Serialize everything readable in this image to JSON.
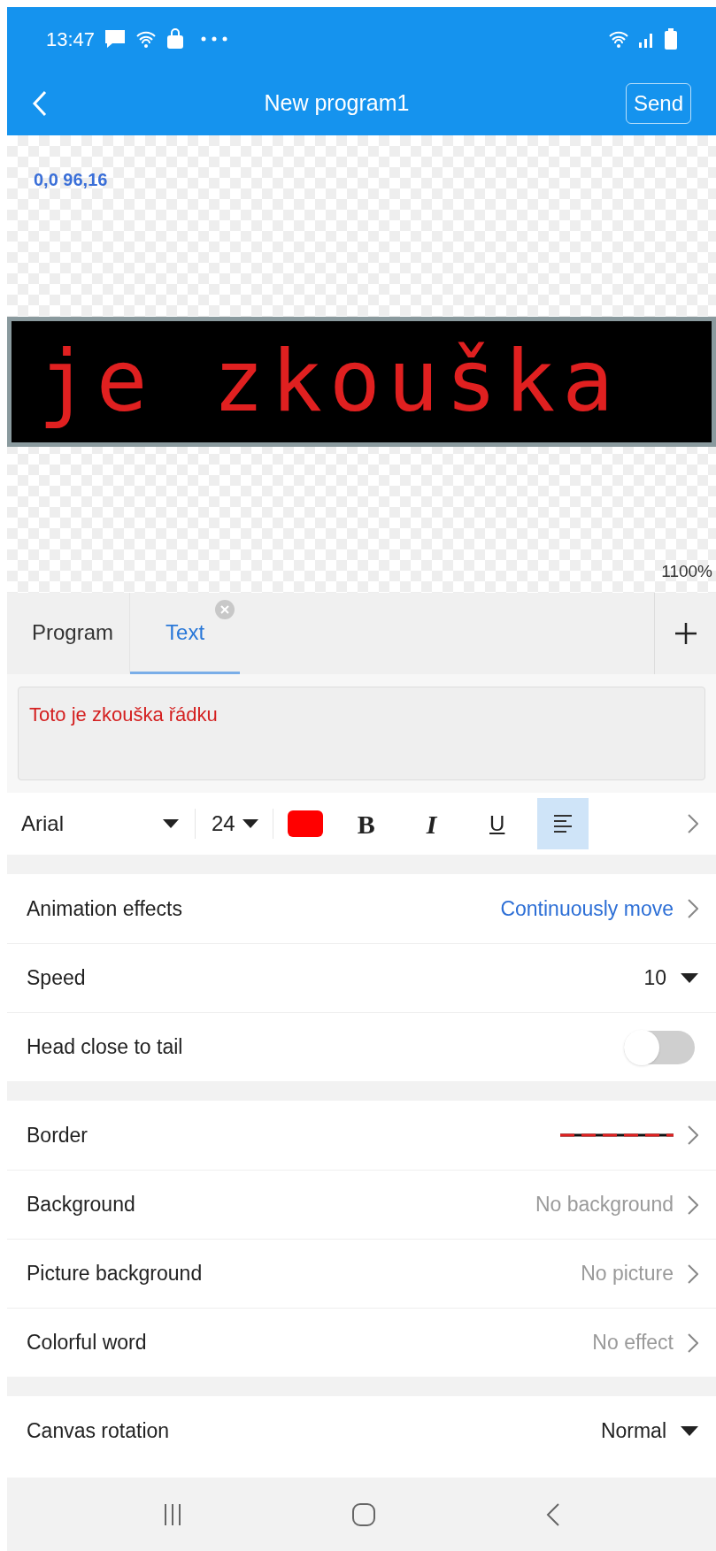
{
  "status_bar": {
    "time": "13:47"
  },
  "app_bar": {
    "title": "New program1",
    "send_button": "Send"
  },
  "canvas": {
    "coordinates": "0,0 96,16",
    "led_text": "je zkouška",
    "zoom": "1100%"
  },
  "tabs": [
    {
      "label": "Program",
      "selected": false,
      "closable": false
    },
    {
      "label": "Text",
      "selected": true,
      "closable": true
    }
  ],
  "text_input": {
    "value": "Toto je zkouška řádku"
  },
  "format_toolbar": {
    "font": "Arial",
    "size": "24",
    "color": "#ff0000",
    "buttons": [
      {
        "kind": "bold",
        "label": "B",
        "on": false
      },
      {
        "kind": "italic",
        "label": "I",
        "on": false
      },
      {
        "kind": "underline",
        "label": "U",
        "on": false
      },
      {
        "kind": "align",
        "on": true
      }
    ]
  },
  "settings_groups": [
    [
      {
        "kind": "link",
        "label": "Animation effects",
        "value": "Continuously move",
        "highlighted": true
      },
      {
        "kind": "dropdown",
        "label": "Speed",
        "value": "10"
      },
      {
        "kind": "toggle",
        "label": "Head close to tail",
        "on": false
      }
    ],
    [
      {
        "kind": "border",
        "label": "Border"
      },
      {
        "kind": "link",
        "label": "Background",
        "value": "No background",
        "highlighted": false
      },
      {
        "kind": "link",
        "label": "Picture background",
        "value": "No picture",
        "highlighted": false
      },
      {
        "kind": "link",
        "label": "Colorful word",
        "value": "No effect",
        "highlighted": false
      }
    ],
    [
      {
        "kind": "dropdown",
        "label": "Canvas rotation",
        "value": "Normal"
      }
    ]
  ]
}
